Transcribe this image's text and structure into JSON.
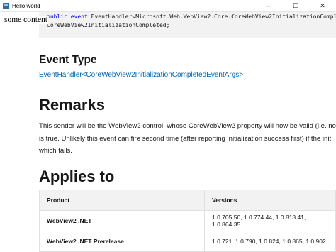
{
  "window": {
    "title": "Hello world",
    "controls": {
      "minimize": "—",
      "maximize": "☐",
      "close": "✕"
    }
  },
  "overlay_text": "some content",
  "code": {
    "keyword1": "public",
    "keyword2": "event",
    "line1_rest": " EventHandler<Microsoft.Web.WebView2.Core.CoreWebView2InitializationComplet",
    "line2": "CoreWebView2InitializationCompleted;"
  },
  "event_type": {
    "heading": "Event Type",
    "link": "EventHandler<CoreWebView2InitializationCompletedEventArgs>"
  },
  "remarks": {
    "heading": "Remarks",
    "lines": [
      "This sender will be the WebView2 control, whose CoreWebView2 property will now be valid (i.e. no",
      "is true. Unlikely this event can fire second time (after reporting initialization success first) if the init",
      "which fails."
    ]
  },
  "applies_to": {
    "heading": "Applies to",
    "columns": [
      "Product",
      "Versions"
    ],
    "rows": [
      {
        "product": "WebView2 .NET",
        "versions": "1.0.705.50, 1.0.774.44, 1.0.818.41, 1.0.864.35"
      },
      {
        "product": "WebView2 .NET Prerelease",
        "versions": "1.0.721, 1.0.790, 1.0.824, 1.0.865, 1.0.902"
      }
    ]
  }
}
